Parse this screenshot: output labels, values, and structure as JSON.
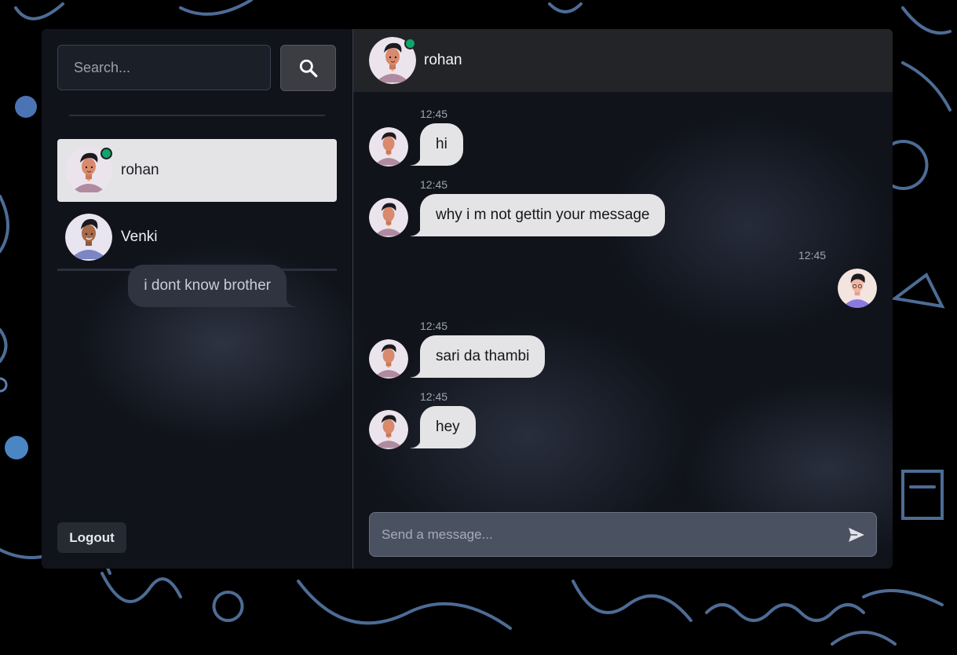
{
  "colors": {
    "online": "#13a46a",
    "incoming_bubble": "#e4e4e6",
    "outgoing_bubble": "#2f3440",
    "header_bg": "#232427"
  },
  "sidebar": {
    "search": {
      "placeholder": "Search..."
    },
    "search_icon": "search-icon",
    "contacts": [
      {
        "name": "rohan",
        "online": true,
        "active": true
      },
      {
        "name": "Venki",
        "online": false,
        "active": false
      }
    ],
    "logout_label": "Logout"
  },
  "chat": {
    "header": {
      "name": "rohan",
      "online": true
    },
    "messages": [
      {
        "time": "12:45",
        "text": "hi",
        "direction": "incoming"
      },
      {
        "time": "12:45",
        "text": "why i m not gettin your message",
        "direction": "incoming"
      },
      {
        "time": "12:45",
        "text": "i dont know brother",
        "direction": "outgoing"
      },
      {
        "time": "12:45",
        "text": "sari da thambi",
        "direction": "incoming"
      },
      {
        "time": "12:45",
        "text": "hey",
        "direction": "incoming"
      }
    ],
    "composer": {
      "placeholder": "Send a message...",
      "send_icon": "send-icon"
    }
  }
}
